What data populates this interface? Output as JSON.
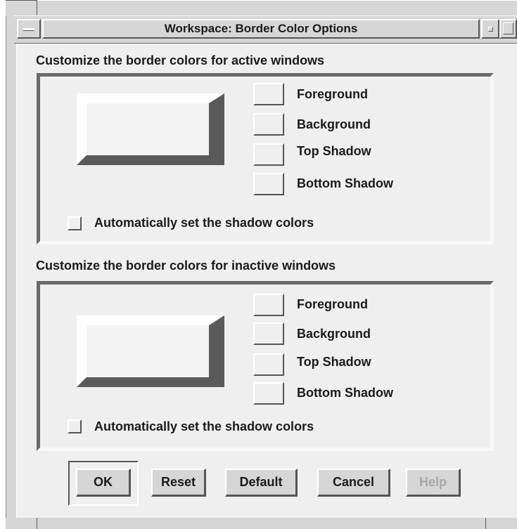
{
  "window": {
    "title": "Workspace: Border Color Options",
    "menu_icon": "window-menu-icon",
    "minimize_icon": "minimize-icon",
    "maximize_icon": "maximize-icon"
  },
  "active": {
    "heading": "Customize the border colors for active windows",
    "foreground": "Foreground",
    "background": "Background",
    "top_shadow": "Top Shadow",
    "bottom_shadow": "Bottom Shadow",
    "auto_shadow": "Automatically set the shadow colors",
    "auto_shadow_checked": false
  },
  "inactive": {
    "heading": "Customize the border colors for inactive windows",
    "foreground": "Foreground",
    "background": "Background",
    "top_shadow": "Top Shadow",
    "bottom_shadow": "Bottom Shadow",
    "auto_shadow": "Automatically set the shadow colors",
    "auto_shadow_checked": false
  },
  "buttons": {
    "ok": "OK",
    "reset": "Reset",
    "default": "Default",
    "cancel": "Cancel",
    "help": "Help"
  },
  "colors": {
    "face": "#efefef",
    "chrome": "#d6d6d6",
    "shadow": "#555555",
    "highlight": "#ffffff",
    "disabled_text": "#a8a8a8"
  }
}
